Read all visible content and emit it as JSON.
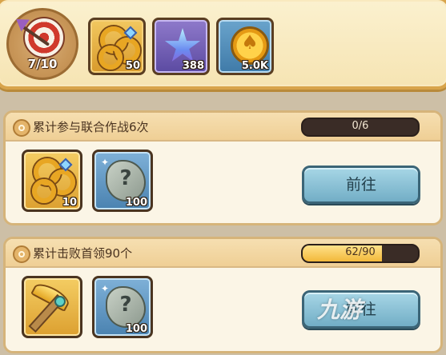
{
  "resources": {
    "target": {
      "icon": "target-arrow-icon",
      "count": "7/10"
    },
    "items": [
      {
        "icon": "gold-key-icon",
        "count": "50",
        "color": "#dca030"
      },
      {
        "icon": "blue-star-icon",
        "count": "388",
        "color": "#5b4aa1"
      },
      {
        "icon": "gold-coin-icon",
        "count": "5.0K",
        "color": "#3f7aa8"
      }
    ]
  },
  "tasks": [
    {
      "title": "累计参与联合作战6次",
      "progress_text": "0/6",
      "progress_fraction": 0.0,
      "rewards": [
        {
          "icon": "gold-key-icon",
          "count": "10"
        },
        {
          "icon": "mystery-rock-icon",
          "count": "100"
        }
      ],
      "button_label": "前往"
    },
    {
      "title": "累计击败首领90个",
      "progress_text": "62/90",
      "progress_fraction": 0.689,
      "rewards": [
        {
          "icon": "golden-pickaxe-icon",
          "count": ""
        },
        {
          "icon": "mystery-rock-icon",
          "count": "100"
        }
      ],
      "button_label": "前往"
    }
  ],
  "watermark": "九游"
}
